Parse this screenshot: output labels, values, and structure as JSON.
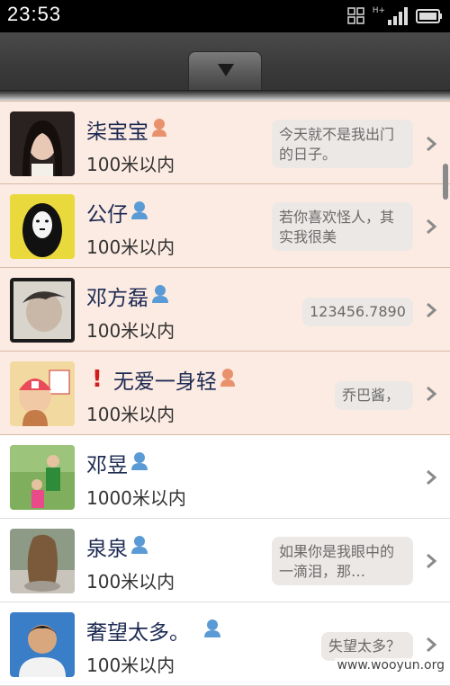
{
  "status_bar": {
    "time": "23:53",
    "network_label": "H+"
  },
  "users": [
    {
      "name": "柒宝宝",
      "gender": "female",
      "distance": "100米以内",
      "signature": "今天就不是我出门的日子。",
      "alert": false
    },
    {
      "name": "公仔",
      "gender": "male",
      "distance": "100米以内",
      "signature": "若你喜欢怪人，其实我很美",
      "alert": false
    },
    {
      "name": "邓方磊",
      "gender": "male",
      "distance": "100米以内",
      "signature": "123456.7890",
      "alert": false
    },
    {
      "name": "无爱一身轻",
      "gender": "female",
      "distance": "100米以内",
      "signature": "乔巴酱，",
      "alert": true,
      "alert_mark": "!"
    },
    {
      "name": "邓昱",
      "gender": "male",
      "distance": "1000米以内",
      "signature": "",
      "alert": false
    },
    {
      "name": "泉泉",
      "gender": "male",
      "distance": "100米以内",
      "signature": "如果你是我眼中的一滴泪，那…",
      "alert": false
    },
    {
      "name": "奢望太多。",
      "gender": "male",
      "distance": "100米以内",
      "signature": "失望太多？",
      "alert": false
    }
  ],
  "watermark": "www.wooyun.org",
  "colors": {
    "female_icon": "#e8916c",
    "male_icon": "#5a9bd5",
    "highlight_row": "#fcebe2",
    "name_text": "#1c2a52"
  }
}
